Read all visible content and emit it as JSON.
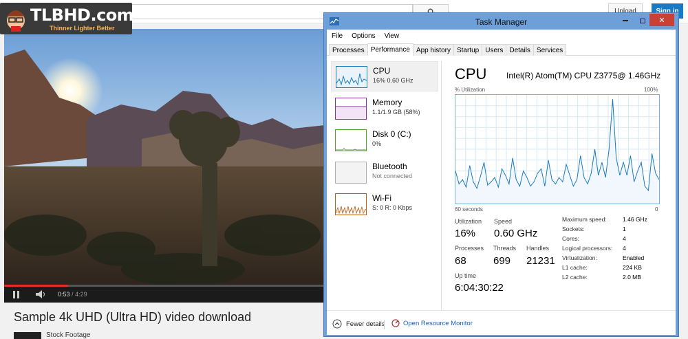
{
  "youtube": {
    "upload_label": "Upload",
    "signin_label": "Sign in",
    "video_title": "Sample 4k UHD (Ultra HD) video download",
    "channel_name": "Stock Footage",
    "time_current": "0:53",
    "time_total": "4:29",
    "progress_fraction": 0.199
  },
  "watermark": {
    "title": "TLBHD.com",
    "tagline": "Thinner Lighter Better"
  },
  "task_manager": {
    "title": "Task Manager",
    "menu": [
      "File",
      "Options",
      "View"
    ],
    "tabs": [
      "Processes",
      "Performance",
      "App history",
      "Startup",
      "Users",
      "Details",
      "Services"
    ],
    "active_tab": "Performance",
    "sidebar": [
      {
        "name": "CPU",
        "sub": "16% 0.60 GHz",
        "color": "#1b7bbf"
      },
      {
        "name": "Memory",
        "sub": "1.1/1.9 GB (58%)",
        "color": "#8b2fa5"
      },
      {
        "name": "Disk 0 (C:)",
        "sub": "0%",
        "color": "#4ea82b"
      },
      {
        "name": "Bluetooth",
        "sub": "Not connected",
        "color": "#b0b0b0"
      },
      {
        "name": "Wi-Fi",
        "sub": "S: 0 R: 0 Kbps",
        "color": "#b5631c"
      }
    ],
    "detail": {
      "title": "CPU",
      "model": "Intel(R) Atom(TM) CPU Z3775@ 1.46GHz",
      "util_label": "% Utilization",
      "max_label": "100%",
      "time_label": "60 seconds",
      "zero_label": "0",
      "utilization_label": "Utilization",
      "utilization": "16%",
      "speed_label": "Speed",
      "speed": "0.60 GHz",
      "processes_label": "Processes",
      "processes": "68",
      "threads_label": "Threads",
      "threads": "699",
      "handles_label": "Handles",
      "handles": "21231",
      "uptime_label": "Up time",
      "uptime": "6:04:30:22",
      "specs": [
        {
          "k": "Maximum speed:",
          "v": "1.46 GHz"
        },
        {
          "k": "Sockets:",
          "v": "1"
        },
        {
          "k": "Cores:",
          "v": "4"
        },
        {
          "k": "Logical processors:",
          "v": "4"
        },
        {
          "k": "Virtualization:",
          "v": "Enabled"
        },
        {
          "k": "L1 cache:",
          "v": "224 KB"
        },
        {
          "k": "L2 cache:",
          "v": "2.0 MB"
        }
      ]
    },
    "footer": {
      "fewer_details": "Fewer details",
      "open_monitor": "Open Resource Monitor"
    },
    "cpu_history": [
      30,
      18,
      22,
      15,
      35,
      20,
      14,
      25,
      38,
      17,
      20,
      24,
      15,
      32,
      26,
      18,
      42,
      22,
      16,
      30,
      24,
      16,
      20,
      28,
      32,
      16,
      40,
      22,
      18,
      24,
      20,
      36,
      26,
      16,
      22,
      44,
      24,
      18,
      28,
      50,
      26,
      38,
      24,
      50,
      96,
      42,
      26,
      38,
      26,
      44,
      20,
      30,
      38,
      16,
      12,
      46,
      28,
      22
    ]
  }
}
